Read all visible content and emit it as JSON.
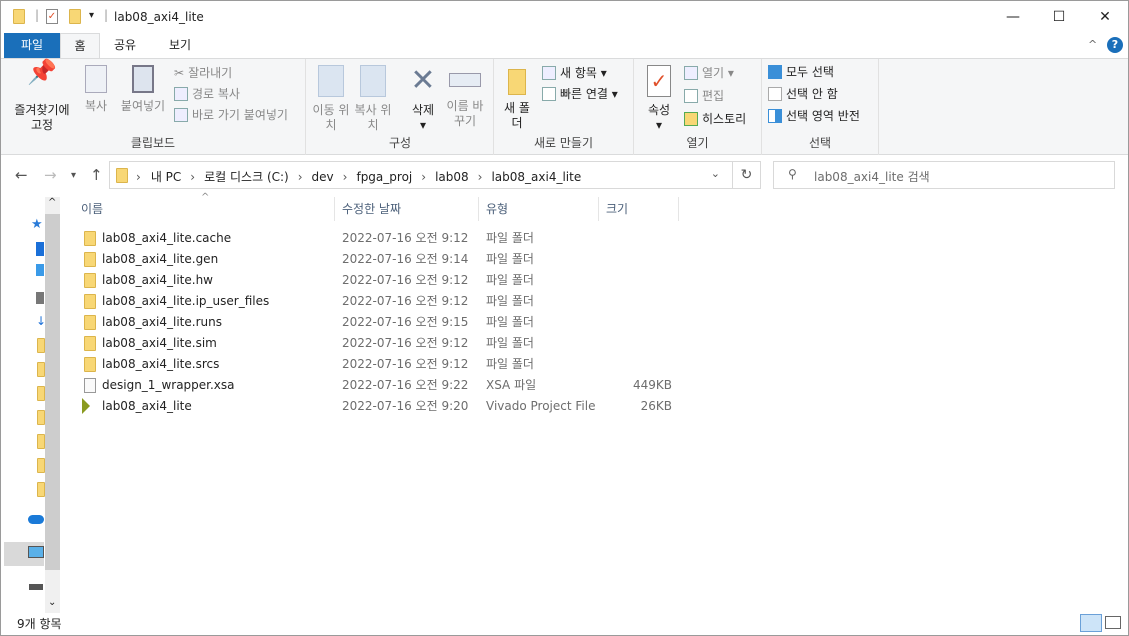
{
  "window": {
    "title": "lab08_axi4_lite",
    "minimize": "—",
    "maximize": "☐",
    "close": "✕"
  },
  "tabs": [
    {
      "label": "파일"
    },
    {
      "label": "홈"
    },
    {
      "label": "공유"
    },
    {
      "label": "보기"
    }
  ],
  "ribbon": {
    "clipboard": {
      "label": "클립보드",
      "pin": "즐겨찾기에 고정",
      "copy": "복사",
      "paste": "붙여넣기",
      "cut": "잘라내기",
      "copy_path": "경로 복사",
      "paste_shortcut": "바로 가기 붙여넣기"
    },
    "organize": {
      "label": "구성",
      "move": "이동 위치",
      "copy_to": "복사 위치",
      "delete": "삭제",
      "rename": "이름 바꾸기"
    },
    "new": {
      "label": "새로 만들기",
      "new_folder": "새 폴더",
      "new_item": "새 항목",
      "easy_access": "빠른 연결"
    },
    "open": {
      "label": "열기",
      "properties": "속성",
      "open": "열기",
      "edit": "편집",
      "history": "히스토리"
    },
    "select": {
      "label": "선택",
      "select_all": "모두 선택",
      "select_none": "선택 안 함",
      "invert": "선택 영역 반전"
    }
  },
  "address": {
    "crumbs": [
      "내 PC",
      "로컬 디스크 (C:)",
      "dev",
      "fpga_proj",
      "lab08",
      "lab08_axi4_lite"
    ]
  },
  "search": {
    "placeholder": "lab08_axi4_lite 검색"
  },
  "columns": {
    "name": "이름",
    "date": "수정한 날짜",
    "type": "유형",
    "size": "크기"
  },
  "files": [
    {
      "name": "lab08_axi4_lite.cache",
      "date": "2022-07-16 오전 9:12",
      "type": "파일 폴더",
      "size": "",
      "icon": "folder"
    },
    {
      "name": "lab08_axi4_lite.gen",
      "date": "2022-07-16 오전 9:14",
      "type": "파일 폴더",
      "size": "",
      "icon": "folder"
    },
    {
      "name": "lab08_axi4_lite.hw",
      "date": "2022-07-16 오전 9:12",
      "type": "파일 폴더",
      "size": "",
      "icon": "folder"
    },
    {
      "name": "lab08_axi4_lite.ip_user_files",
      "date": "2022-07-16 오전 9:12",
      "type": "파일 폴더",
      "size": "",
      "icon": "folder"
    },
    {
      "name": "lab08_axi4_lite.runs",
      "date": "2022-07-16 오전 9:15",
      "type": "파일 폴더",
      "size": "",
      "icon": "folder"
    },
    {
      "name": "lab08_axi4_lite.sim",
      "date": "2022-07-16 오전 9:12",
      "type": "파일 폴더",
      "size": "",
      "icon": "folder"
    },
    {
      "name": "lab08_axi4_lite.srcs",
      "date": "2022-07-16 오전 9:12",
      "type": "파일 폴더",
      "size": "",
      "icon": "folder"
    },
    {
      "name": "design_1_wrapper.xsa",
      "date": "2022-07-16 오전 9:22",
      "type": "XSA 파일",
      "size": "449KB",
      "icon": "file"
    },
    {
      "name": "lab08_axi4_lite",
      "date": "2022-07-16 오전 9:20",
      "type": "Vivado Project File",
      "size": "26KB",
      "icon": "vivado"
    }
  ],
  "status": {
    "count": "9개 항목"
  },
  "colors": {
    "accent": "#1a6fba"
  }
}
